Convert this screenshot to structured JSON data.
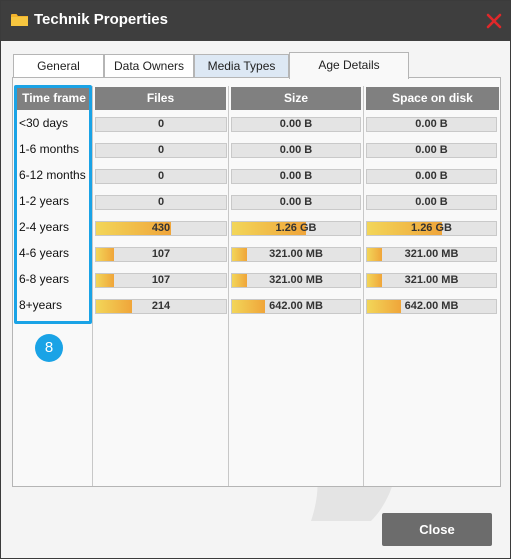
{
  "window": {
    "title": "Technik Properties",
    "icons": {
      "folder": "folder-icon",
      "close": "close-icon"
    },
    "colors": {
      "titlebar": "#3e3e3e",
      "close": "#e0282a",
      "highlight": "#1aa3e6",
      "bar_start": "#f2d659",
      "bar_end": "#f0a53a"
    }
  },
  "tabs": [
    {
      "label": "General"
    },
    {
      "label": "Data Owners"
    },
    {
      "label": "Media Types"
    },
    {
      "label": "Age Details",
      "active": true
    }
  ],
  "table": {
    "headers": {
      "timeframe": "Time frame",
      "files": "Files",
      "size": "Size",
      "space": "Space on disk"
    },
    "rows": [
      {
        "timeframe": "<30 days",
        "files": "0",
        "size": "0.00 B",
        "space": "0.00 B",
        "files_pct": 0,
        "size_pct": 0,
        "space_pct": 0
      },
      {
        "timeframe": "1-6 months",
        "files": "0",
        "size": "0.00 B",
        "space": "0.00 B",
        "files_pct": 0,
        "size_pct": 0,
        "space_pct": 0
      },
      {
        "timeframe": "6-12 months",
        "files": "0",
        "size": "0.00 B",
        "space": "0.00 B",
        "files_pct": 0,
        "size_pct": 0,
        "space_pct": 0
      },
      {
        "timeframe": "1-2 years",
        "files": "0",
        "size": "0.00 B",
        "space": "0.00 B",
        "files_pct": 0,
        "size_pct": 0,
        "space_pct": 0
      },
      {
        "timeframe": "2-4 years",
        "files": "430",
        "size": "1.26 GB",
        "space": "1.26 GB",
        "files_pct": 0.58,
        "size_pct": 0.58,
        "space_pct": 0.58
      },
      {
        "timeframe": "4-6 years",
        "files": "107",
        "size": "321.00 MB",
        "space": "321.00 MB",
        "files_pct": 0.14,
        "size_pct": 0.12,
        "space_pct": 0.12
      },
      {
        "timeframe": "6-8 years",
        "files": "107",
        "size": "321.00 MB",
        "space": "321.00 MB",
        "files_pct": 0.14,
        "size_pct": 0.12,
        "space_pct": 0.12
      },
      {
        "timeframe": "8+years",
        "files": "214",
        "size": "642.00 MB",
        "space": "642.00 MB",
        "files_pct": 0.28,
        "size_pct": 0.26,
        "space_pct": 0.26
      }
    ]
  },
  "badge": {
    "number": "8"
  },
  "footer": {
    "close_label": "Close"
  }
}
